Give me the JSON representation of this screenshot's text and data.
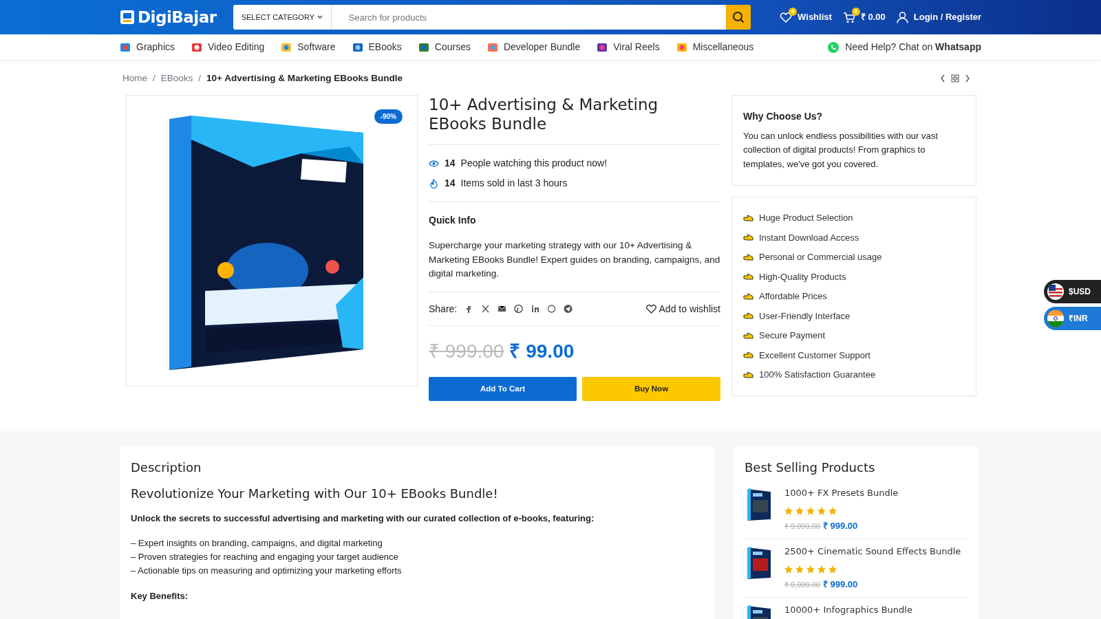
{
  "header": {
    "logo": "DigiBajar",
    "category_select": "SELECT CATEGORY",
    "search": {
      "placeholder": "Search for products"
    },
    "wishlist": {
      "label": "Wishlist",
      "count": "0"
    },
    "cart": {
      "count": "0",
      "total": "₹ 0.00"
    },
    "login": "Login / Register"
  },
  "nav": {
    "items": [
      "Graphics",
      "Video Editing",
      "Software",
      "EBooks",
      "Courses",
      "Developer Bundle",
      "Viral Reels",
      "Miscellaneous"
    ],
    "help": "Need Help? Chat on **Whatsapp**"
  },
  "breadcrumb": [
    {
      "kind": "link",
      "text": "Home"
    },
    {
      "kind": "separator",
      "text": "/"
    },
    {
      "kind": "link",
      "text": "EBooks"
    },
    {
      "kind": "separator",
      "text": "/"
    },
    {
      "kind": "current",
      "text": "10+ Advertising & Marketing EBooks Bundle"
    }
  ],
  "product": {
    "badge": "-90%",
    "title": "10+ Advertising & Marketing EBooks Bundle",
    "stats": [
      {
        "kind": "watching",
        "count": "14",
        "text": "People watching this product now!"
      },
      {
        "kind": "sold",
        "count": "14",
        "text": "Items sold in last 3 hours"
      }
    ],
    "quick_info_title": "Quick Info",
    "quick_info": "Supercharge your marketing strategy with our 10+ Advertising & Marketing EBooks Bundle! Expert guides on branding, campaigns, and digital marketing.",
    "share_label": "Share:",
    "wishlist_link": "Add to wishlist",
    "old_price": "₹ 999.00",
    "price": "₹ 99.00",
    "buttons": [
      {
        "kind": "cart",
        "label": "Add To Cart"
      },
      {
        "kind": "buy",
        "label": "Buy Now"
      }
    ]
  },
  "why": {
    "title": "Why Choose Us?",
    "text": "You can unlock endless possibilities with our vast collection of digital products! From graphics to templates, we've got you covered."
  },
  "features": [
    "Huge Product Selection",
    "Instant Download Access",
    "Personal or Commercial usage",
    "High-Quality Products",
    "Affordable Prices",
    "User-Friendly Interface",
    "Secure Payment",
    "Excellent Customer Support",
    "100% Satisfaction Guarantee"
  ],
  "currency": [
    {
      "label": "$USD",
      "selected": false
    },
    {
      "label": "₹INR",
      "selected": true
    }
  ],
  "description": {
    "title": "Description",
    "heading": "Revolutionize Your Marketing with Our 10+ EBooks Bundle!",
    "intro": "Unlock the secrets to successful advertising and marketing with our curated collection of e-books, featuring:",
    "bullets": [
      "– Expert insights on branding, campaigns, and digital marketing",
      "– Proven strategies for reaching and engaging your target audience",
      "– Actionable tips on measuring and optimizing your marketing efforts"
    ],
    "subheading": "Key Benefits:"
  },
  "best_selling": {
    "title": "Best Selling Products",
    "items": [
      {
        "name": "1000+ FX Presets Bundle",
        "stars": 5,
        "old_price": "₹ 9,999.00",
        "price": "₹ 999.00"
      },
      {
        "name": "2500+ Cinematic Sound Effects Bundle",
        "stars": 5,
        "old_price": "₹ 9,999.00",
        "price": "₹ 999.00"
      },
      {
        "name": "10000+ Infographics Bundle"
      }
    ]
  }
}
